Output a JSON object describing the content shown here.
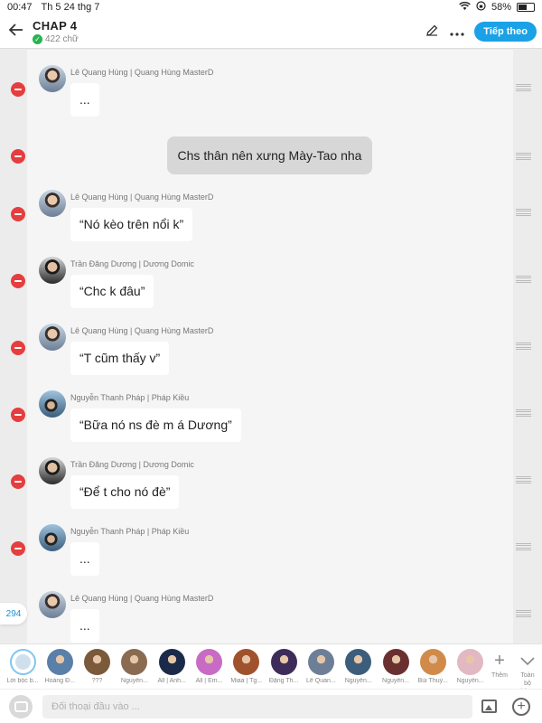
{
  "status_bar": {
    "time": "00:47",
    "date": "Th 5 24 thg 7",
    "battery": "58%",
    "battery_level": 0.58
  },
  "header": {
    "title": "CHAP 4",
    "word_count": "422 chữ",
    "next_label": "Tiếp theo",
    "icons": [
      "back-arrow-icon",
      "pencil-icon",
      "more-dots-icon",
      "check-icon"
    ]
  },
  "messages": [
    {
      "type": "message",
      "sender": "Lê Quang Hùng | Quang Hùng MasterD",
      "text": "...",
      "avatar": "a1"
    },
    {
      "type": "narration",
      "text": "Chs thân nên xưng Mày-Tao nha"
    },
    {
      "type": "message",
      "sender": "Lê Quang Hùng | Quang Hùng MasterD",
      "text": "“Nó kèo trên nổi k”",
      "avatar": "a1"
    },
    {
      "type": "message",
      "sender": "Trần Đăng Dương | Dương Domic",
      "text": "“Chc k đâu”",
      "avatar": "a2"
    },
    {
      "type": "message",
      "sender": "Lê Quang Hùng | Quang Hùng MasterD",
      "text": "“T cũm thấy v”",
      "avatar": "a1"
    },
    {
      "type": "message",
      "sender": "Nguyễn Thanh Pháp | Pháp Kiều",
      "text": "“Bữa nó ns đè m á Dương”",
      "avatar": "a3"
    },
    {
      "type": "message",
      "sender": "Trần Đăng Dương | Dương Domic",
      "text": "“Để t cho nó đè”",
      "avatar": "a2"
    },
    {
      "type": "message",
      "sender": "Nguyễn Thanh Pháp | Pháp Kiều",
      "text": "...",
      "avatar": "a3"
    },
    {
      "type": "message",
      "sender": "Lê Quang Hùng | Quang Hùng MasterD",
      "text": "...",
      "avatar": "a1"
    }
  ],
  "count_badge": "294",
  "characters": [
    {
      "name": "Lời bốc b...",
      "selected": true
    },
    {
      "name": "Hoàng Đ...",
      "color": "#5a7fa8"
    },
    {
      "name": "???",
      "color": "#7a5a3a"
    },
    {
      "name": "Nguyễn...",
      "color": "#8a6a50"
    },
    {
      "name": "All | Anh...",
      "color": "#1c2a4a"
    },
    {
      "name": "All | Em...",
      "color": "#c86bc4"
    },
    {
      "name": "Miaa | Tg...",
      "color": "#a0522d"
    },
    {
      "name": "Đặng Th...",
      "color": "#3d2c5a"
    },
    {
      "name": "Lê Quan...",
      "color": "#6d7f96"
    },
    {
      "name": "Nguyễn...",
      "color": "#3c5e7c"
    },
    {
      "name": "Nguyễn...",
      "color": "#6a3030"
    },
    {
      "name": "Bùi Thuỳ...",
      "color": "#d08b4a"
    },
    {
      "name": "Nguyễn...",
      "color": "#e2b8c2"
    }
  ],
  "add_label": "Thêm",
  "all_label": "Toàn bộ bảng",
  "input_placeholder": "Đối thoại đầu vào ...",
  "colors": {
    "accent": "#1aa1e6",
    "delete": "#e53e3e",
    "check": "#2ab24f"
  }
}
